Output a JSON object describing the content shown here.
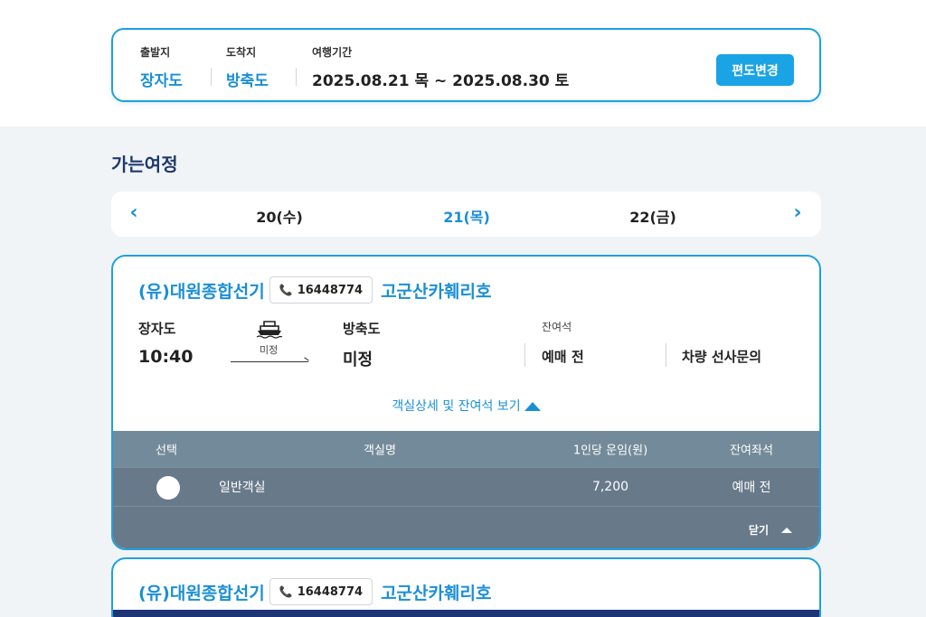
{
  "search": {
    "departure_label": "출발지",
    "departure_value": "장자도",
    "arrival_label": "도착지",
    "arrival_value": "방축도",
    "period_label": "여행기간",
    "period_value": "2025.08.21 목 ~ 2025.08.30 토",
    "change_button": "편도변경"
  },
  "section_title": "가는여정",
  "date_nav": {
    "prev_icon": "chevron-left-icon",
    "next_icon": "chevron-right-icon",
    "prev_symbol": "‹",
    "next_symbol": "›",
    "dates": [
      "20(수)",
      "21(목)",
      "22(금)"
    ],
    "selected_index": 1
  },
  "voyages": [
    {
      "company": "(유)대원종합선기",
      "phone": "16448774",
      "ship": "고군산카훼리호",
      "from_port": "장자도",
      "departure_time": "10:40",
      "route_label": "미정",
      "to_port": "방축도",
      "arrival_time": "미정",
      "seat_label": "잔여석",
      "seat_status": "예매 전",
      "vehicle_status": "차량 선사문의",
      "detail_link": "객실상세 및 잔여석 보기",
      "table": {
        "headers": [
          "선택",
          "객실명",
          "1인당 운임(원)",
          "잔여좌석"
        ],
        "rows": [
          {
            "room": "일반객실",
            "fare": "7,200",
            "remaining": "예매 전"
          }
        ]
      },
      "close_label": "닫기"
    },
    {
      "company": "(유)대원종합선기",
      "phone": "16448774",
      "ship": "고군산카훼리호"
    }
  ],
  "colors": {
    "accent": "#1a8fd6",
    "button": "#1ba4e5",
    "title": "#1f3a6b",
    "table_header": "#738a9a",
    "table_row": "#68798a",
    "page_bg": "#f1f4f7"
  }
}
